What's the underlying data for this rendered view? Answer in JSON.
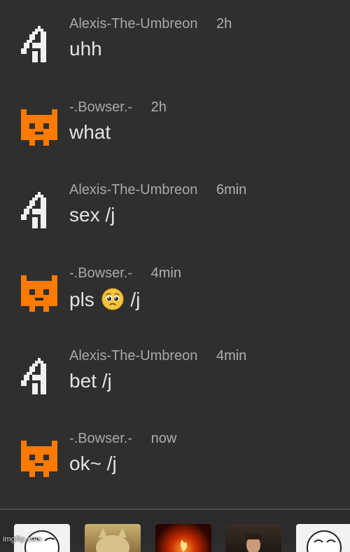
{
  "colors": {
    "background": "#2f2f2f",
    "username": "#a8a8a8",
    "message": "#e3e3e3",
    "bowser_avatar": "#ff7a00",
    "umbreon_avatar": "#f0f0f0"
  },
  "messages": [
    {
      "user": "Alexis-The-Umbreon",
      "time": "2h",
      "text": "uhh",
      "avatar_icon": "pixel-umbreon-icon"
    },
    {
      "user": "-.Bowser.-",
      "time": "2h",
      "text": "what",
      "avatar_icon": "pixel-bowser-icon"
    },
    {
      "user": "Alexis-The-Umbreon",
      "time": "6min",
      "text": "sex /j",
      "avatar_icon": "pixel-umbreon-icon"
    },
    {
      "user": "-.Bowser.-",
      "time": "4min",
      "text_before": "pls",
      "emoji": "pleading-face-emoji",
      "text_after": "/j",
      "avatar_icon": "pixel-bowser-icon"
    },
    {
      "user": "Alexis-The-Umbreon",
      "time": "4min",
      "text": "bet /j",
      "avatar_icon": "pixel-umbreon-icon"
    },
    {
      "user": "-.Bowser.-",
      "time": "now",
      "text": "ok~ /j",
      "avatar_icon": "pixel-bowser-icon"
    }
  ],
  "meme_tray": {
    "items": [
      "meme-face-thumbnail",
      "cat-meme-thumbnail",
      "fire-meme-thumbnail",
      "person-meme-thumbnail",
      "meme-face-thumbnail"
    ]
  },
  "watermark": "imgflip.com"
}
